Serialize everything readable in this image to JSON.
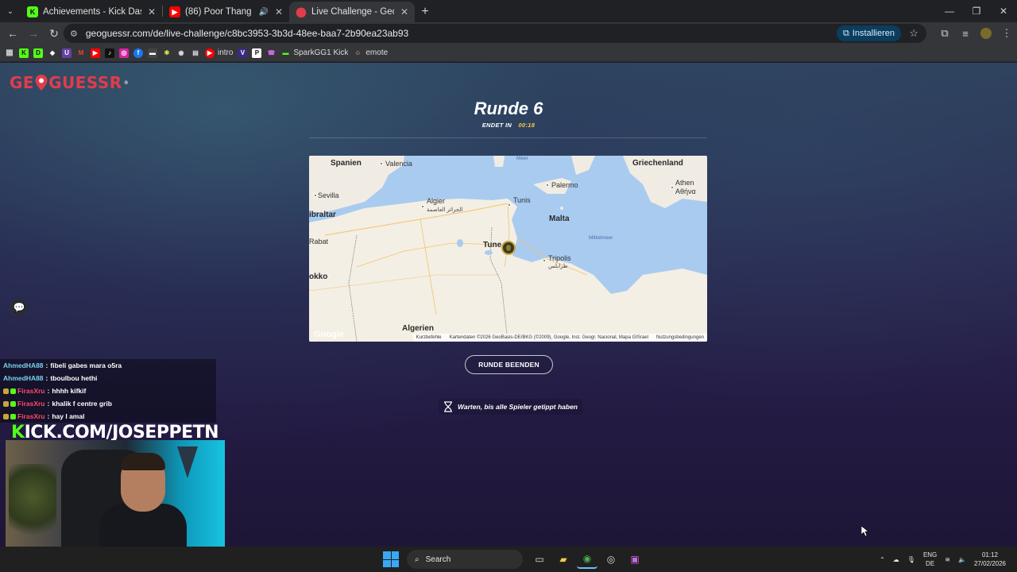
{
  "browser": {
    "tabs": [
      {
        "title": "Achievements - Kick Dashboard",
        "icon": "kick-icon",
        "color": "#53fc18",
        "active": false
      },
      {
        "title": "(86) Poor Thang - YouTube",
        "icon": "youtube-icon",
        "color": "#ff0000",
        "active": false
      },
      {
        "title": "Live Challenge - GeoGuessr",
        "icon": "geoguessr-icon",
        "color": "#e23c4a",
        "active": true
      }
    ],
    "url": "geoguessr.com/de/live-challenge/c8bc3953-3b3d-48ee-baa7-2b90ea23ab93",
    "install_label": "Installieren",
    "bookmarks": [
      {
        "icon": "apps-icon",
        "label": ""
      },
      {
        "icon": "kick-icon",
        "label": ""
      },
      {
        "icon": "d-icon",
        "label": ""
      },
      {
        "icon": "diamond-icon",
        "label": ""
      },
      {
        "icon": "twitch-icon",
        "label": ""
      },
      {
        "icon": "gmail-icon",
        "label": ""
      },
      {
        "icon": "youtube-icon",
        "label": ""
      },
      {
        "icon": "tiktok-icon",
        "label": ""
      },
      {
        "icon": "instagram-icon",
        "label": ""
      },
      {
        "icon": "facebook-icon",
        "label": ""
      },
      {
        "icon": "bookmark-icon",
        "label": ""
      },
      {
        "icon": "plant-icon",
        "label": ""
      },
      {
        "icon": "ring-icon",
        "label": ""
      },
      {
        "icon": "doc-icon",
        "label": ""
      },
      {
        "icon": "intro-icon",
        "label": "intro"
      },
      {
        "icon": "v-icon",
        "label": ""
      },
      {
        "icon": "p-icon",
        "label": ""
      },
      {
        "icon": "phone-icon",
        "label": ""
      },
      {
        "icon": "sparkgg-icon",
        "label": "SparkGG1 Kick"
      },
      {
        "icon": "emote-icon",
        "label": "emote"
      }
    ]
  },
  "game": {
    "logo_text_left": "GE",
    "logo_text_right": "GUESSR",
    "round_title": "Runde 6",
    "ends_label": "ENDET IN",
    "timer": "00:18",
    "end_round_button": "RUNDE BEENDEN",
    "waiting_text": "Warten, bis alle Spieler getippt haben"
  },
  "map": {
    "labels": {
      "spanien": "Spanien",
      "valencia": "Valencia",
      "meer": "Meer",
      "griechenland": "Griechenland",
      "sevilla": "Sevilla",
      "palermo": "Palermo",
      "athen": "Athen",
      "athen_greek": "Αθήνα",
      "algier": "Algier",
      "algier_arabic": "الجزائر العاصمة",
      "tunis": "Tunis",
      "gibraltar": "ibraltar",
      "malta": "Malta",
      "rabat": "Rabat",
      "mittelmeer": "Mittelmeer",
      "tunesien": "Tune",
      "tripolis": "Tripolis",
      "tripolis_arabic": "طرابلس",
      "marokko": "okko",
      "algerien": "Algerien"
    },
    "google_mark": "Google",
    "attribution": [
      "Kurzbefehle",
      "Kartendaten ©2026 GeoBasis-DE/BKG (©2009), Google, Inst. Geogr. Nacional, Mapa GISrael",
      "Nutzungsbedingungen"
    ]
  },
  "chat": [
    {
      "user": "AhmedHA88",
      "message": "fibeli gabes mara o5ra",
      "color": "#7ad0ee",
      "badges": false
    },
    {
      "user": "AhmedHA88",
      "message": "tboulbou hethi",
      "color": "#7ad0ee",
      "badges": false
    },
    {
      "user": "FirasXru",
      "message": "hhhh kifkif",
      "color": "#ff4a6a",
      "badges": true
    },
    {
      "user": "FirasXru",
      "message": "khalik f centre grib",
      "color": "#ff4a6a",
      "badges": true
    },
    {
      "user": "FirasXru",
      "message": "hay l amal",
      "color": "#ff4a6a",
      "badges": true
    }
  ],
  "overlay": {
    "kick_k": "K",
    "kick_rest": "ICK.COM/JOSEPPETN"
  },
  "taskbar": {
    "search_label": "Search",
    "lang_top": "ENG",
    "lang_bottom": "DE",
    "time": "01:12",
    "date": "27/02/2026"
  }
}
